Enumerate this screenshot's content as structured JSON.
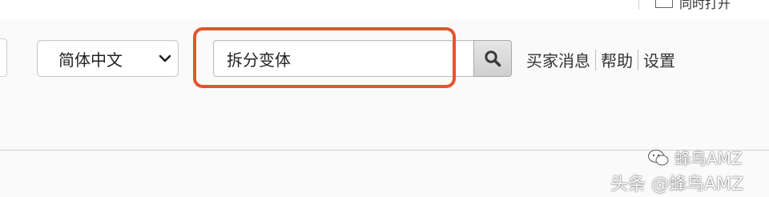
{
  "top_bar": {
    "link_text": "同时打开"
  },
  "language_select": {
    "selected": "简体中文"
  },
  "search": {
    "value": "拆分变体",
    "icon": "search-icon",
    "highlight_color": "#e4542f"
  },
  "nav_links": [
    {
      "label": "买家消息"
    },
    {
      "label": "帮助"
    },
    {
      "label": "设置"
    }
  ],
  "watermark": {
    "line1": "蜂鸟AMZ",
    "line2": "头条 @蜂鸟AMZ"
  }
}
